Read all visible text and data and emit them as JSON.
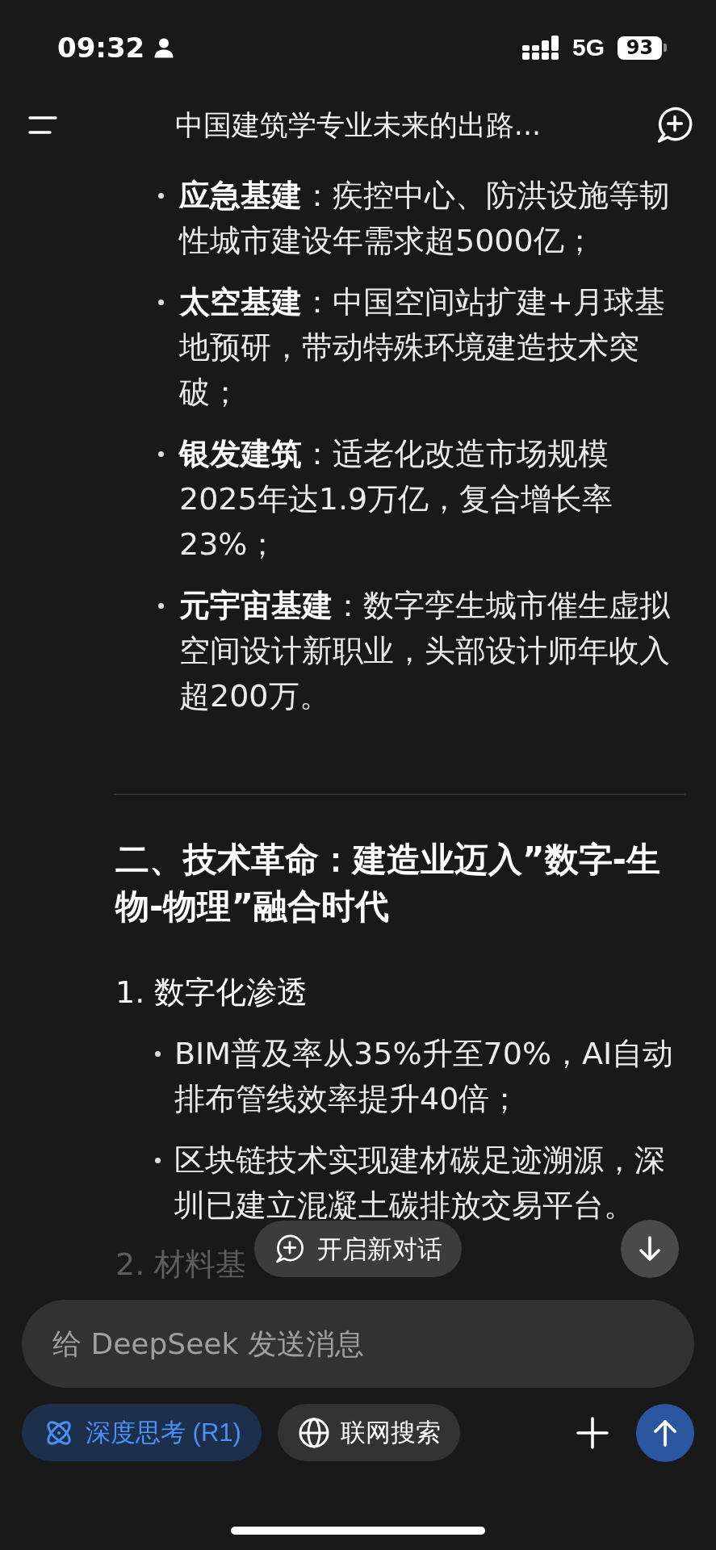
{
  "status_bar": {
    "time": "09:32",
    "network": "5G",
    "battery": "93"
  },
  "header": {
    "title": "中国建筑学专业未来的出路..."
  },
  "message": {
    "bullets": [
      "**应急基建**：疾控中心、防洪设施等韧性城市建设年需求超5000亿；",
      "**太空基建**：中国空间站扩建+月球基地预研，带动特殊环境建造技术突破；",
      "**银发建筑**：适老化改造市场规模 2025年达1.9万亿，复合增长率 23%；",
      "**元宇宙基建**：数字孪生城市催生虚拟空间设计新职业，头部设计师年收入超200万。"
    ],
    "section": {
      "heading": "二、技术革命：建造业迈入”数字-生物-物理”融合时代",
      "items": [
        {
          "title": "1. 数字化渗透",
          "bullets": [
            "BIM普及率从35%升至70%，AI自动排布管线效率提升40倍；",
            "区块链技术实现建材碳足迹溯源，深圳已建立混凝土碳排放交易平台。"
          ]
        },
        {
          "title": "2. 材料基"
        }
      ]
    }
  },
  "new_chat_button": {
    "label": "开启新对话"
  },
  "composer": {
    "placeholder": "给 DeepSeek 发送消息",
    "toggles": [
      {
        "label": "深度思考 (R1)",
        "on": true
      },
      {
        "label": "联网搜索",
        "on": false
      }
    ]
  }
}
